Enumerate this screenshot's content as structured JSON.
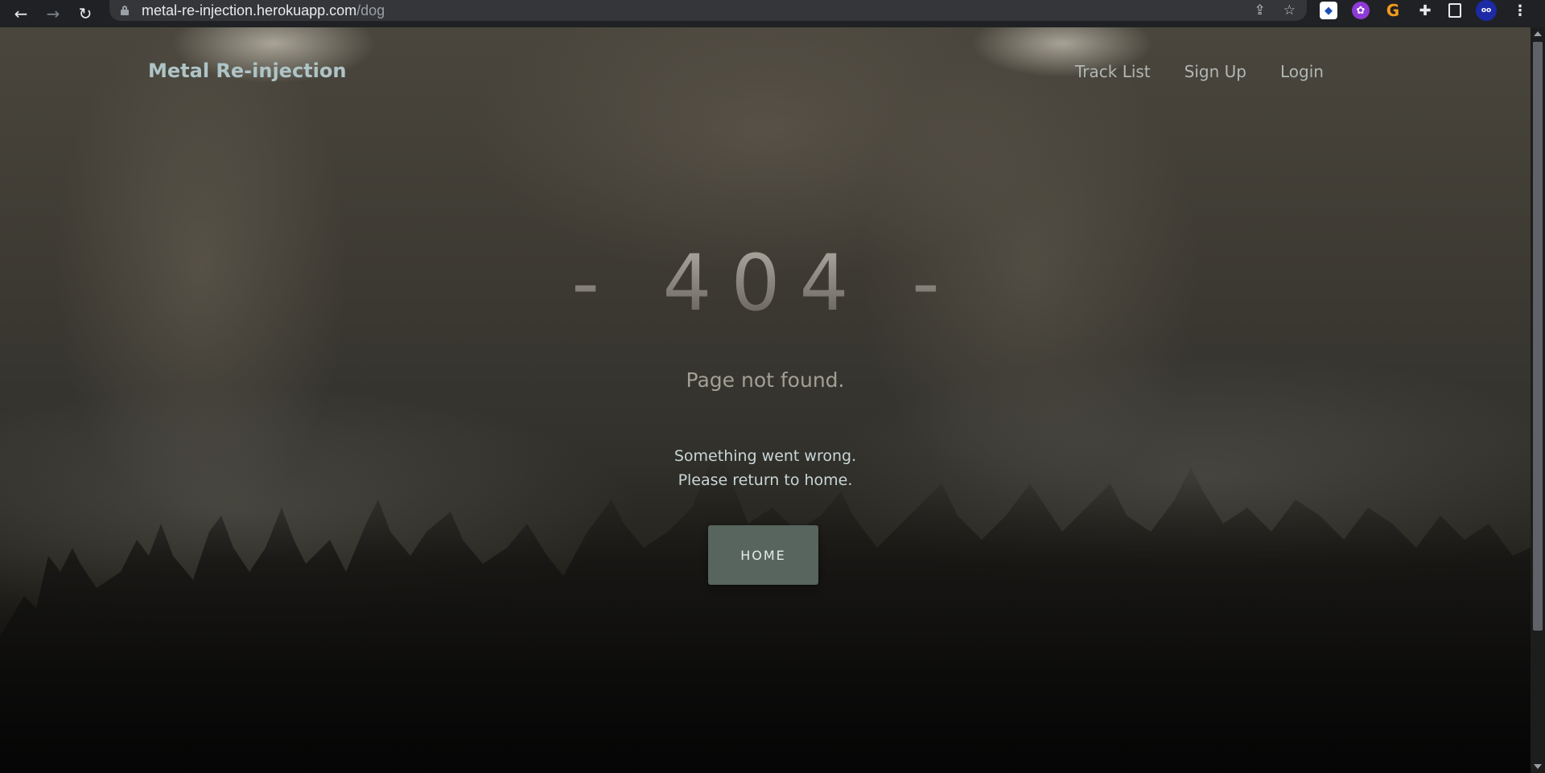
{
  "browser": {
    "back_icon": "arrow-left-icon",
    "forward_icon": "arrow-right-icon",
    "reload_icon": "reload-icon",
    "url_host": "metal-re-injection.herokuapp.com",
    "url_path": "/dog",
    "actions": [
      "share-icon",
      "star-icon"
    ],
    "extensions": [
      "extension-1-icon",
      "extension-2-icon",
      "extension-3-icon",
      "puzzle-icon",
      "side-panel-icon",
      "profile-avatar",
      "menu-icon"
    ]
  },
  "site": {
    "brand": "Metal Re-injection",
    "nav": [
      {
        "label": "Track List"
      },
      {
        "label": "Sign Up"
      },
      {
        "label": "Login"
      }
    ]
  },
  "error": {
    "code": "- 404 -",
    "title": "Page not found.",
    "line1": "Something went wrong.",
    "line2": "Please return to home.",
    "button": "HOME"
  },
  "colors": {
    "brand": "#aec4c7",
    "button_bg": "#58655f",
    "browser_bar": "#202124"
  }
}
